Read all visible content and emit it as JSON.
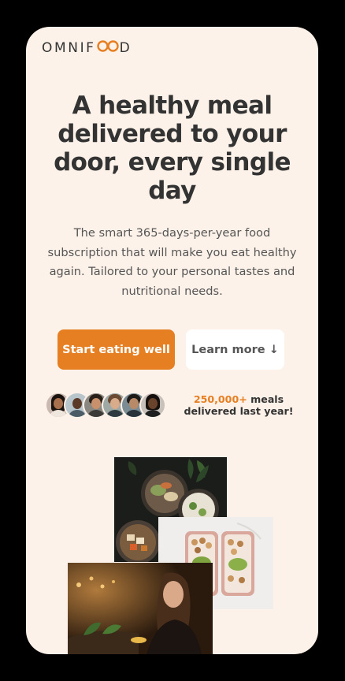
{
  "brand": {
    "logo_text_left": "OMNIF",
    "logo_text_right": "D",
    "accent": "#e67e22"
  },
  "hero": {
    "title": "A healthy meal delivered to your door, every single day",
    "description": "The smart 365-days-per-year food subscription that will make you eat healthy again. Tailored to your personal tastes and nutritional needs.",
    "primary_cta": "Start eating well",
    "secondary_cta": "Learn more ↓"
  },
  "social_proof": {
    "count": "250,000+",
    "text": " meals delivered last year!",
    "avatars": [
      "customer-1",
      "customer-2",
      "customer-3",
      "customer-4",
      "customer-5",
      "customer-6"
    ]
  },
  "colors": {
    "background": "#fdf2e9",
    "text": "#333333",
    "primary": "#e67e22"
  }
}
